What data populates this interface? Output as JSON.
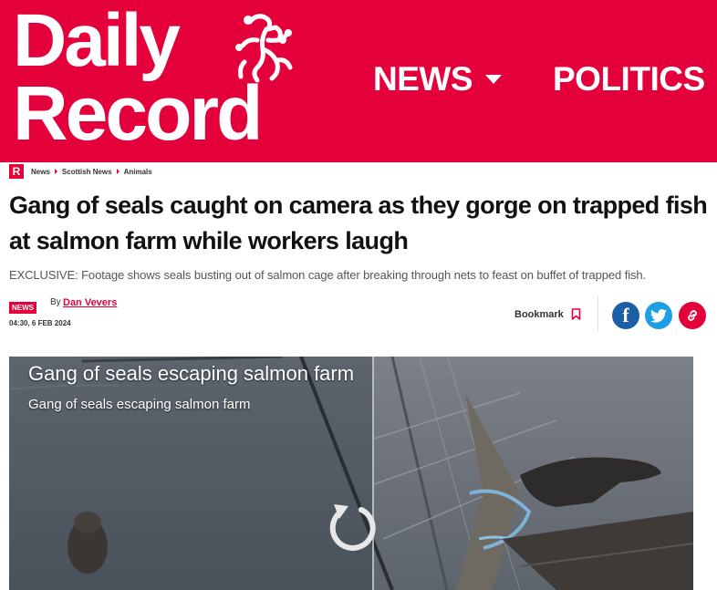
{
  "header": {
    "logo_line1": "Daily",
    "logo_line2": "Record",
    "brand_color": "#e4003b",
    "nav": [
      {
        "label": "NEWS",
        "icon": "chevron-down-icon"
      },
      {
        "label": "POLITICS"
      }
    ]
  },
  "breadcrumb": {
    "badge": "R",
    "items": [
      "News",
      "Scottish News",
      "Animals"
    ]
  },
  "article": {
    "headline": "Gang of seals caught on camera as they gorge on trapped fish at salmon farm while workers laugh",
    "standfirst": "EXCLUSIVE: Footage shows seals busting out of salmon cage after breaking through nets to feast on buffet of trapped fish.",
    "section_badge": "NEWS",
    "by_label": "By",
    "author": "Dan Vevers",
    "datetime": "04:30, 6 FEB 2024",
    "bookmark_label": "Bookmark"
  },
  "share": {
    "icons": [
      "facebook-icon",
      "twitter-icon",
      "link-icon"
    ],
    "colors": {
      "facebook": "#1c5fa8",
      "twitter": "#1d9fe6",
      "link": "#e4003b"
    }
  },
  "video": {
    "title": "Gang of seals escaping salmon farm",
    "subtitle": "Gang of seals escaping salmon farm",
    "control_icon": "replay-icon"
  }
}
